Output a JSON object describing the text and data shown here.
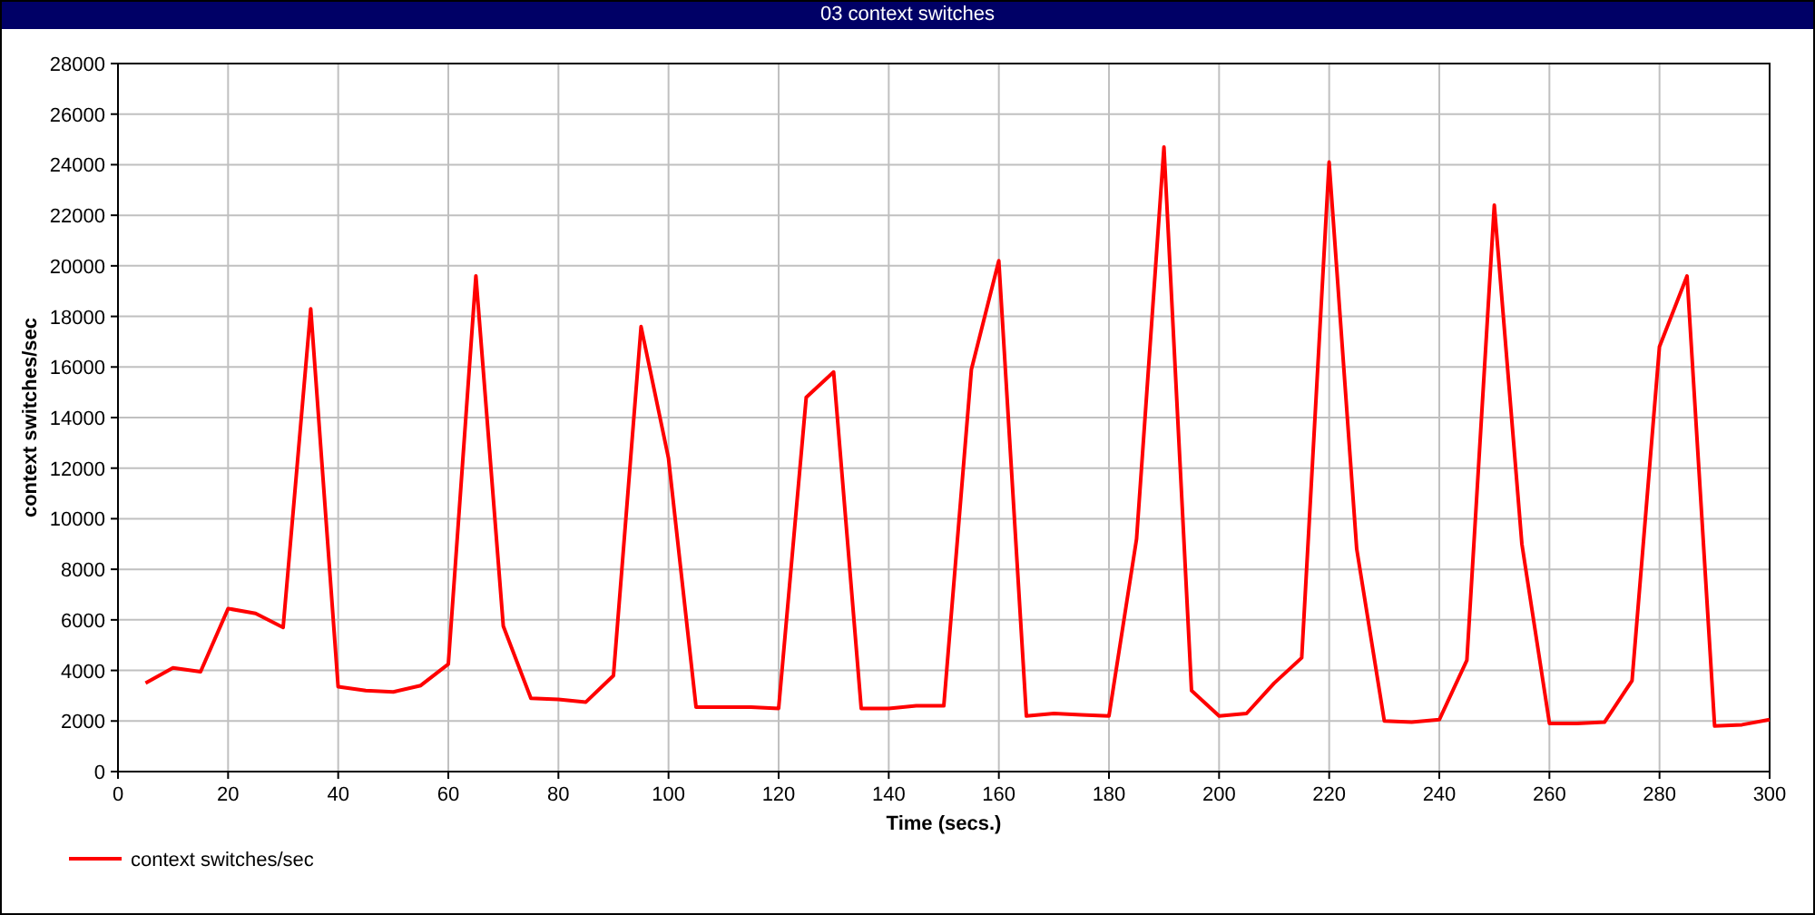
{
  "window": {
    "title": "03 context switches"
  },
  "chart_data": {
    "type": "line",
    "xlabel": "Time (secs.)",
    "ylabel": "context switches/sec",
    "grid": true,
    "xlim": [
      0,
      300
    ],
    "ylim": [
      0,
      28000
    ],
    "xticks": [
      0,
      20,
      40,
      60,
      80,
      100,
      120,
      140,
      160,
      180,
      200,
      220,
      240,
      260,
      280,
      300
    ],
    "yticks": [
      0,
      2000,
      4000,
      6000,
      8000,
      10000,
      12000,
      14000,
      16000,
      18000,
      20000,
      22000,
      24000,
      26000,
      28000
    ],
    "x": [
      5,
      10,
      15,
      20,
      25,
      30,
      35,
      40,
      45,
      50,
      55,
      60,
      65,
      70,
      75,
      80,
      85,
      90,
      95,
      100,
      105,
      110,
      115,
      120,
      125,
      130,
      135,
      140,
      145,
      150,
      155,
      160,
      165,
      170,
      175,
      180,
      185,
      190,
      195,
      200,
      205,
      210,
      215,
      220,
      225,
      230,
      235,
      240,
      245,
      250,
      255,
      260,
      265,
      270,
      275,
      280,
      285,
      290,
      295,
      300
    ],
    "series": [
      {
        "name": "context switches/sec",
        "color": "#ff0000",
        "values": [
          3500,
          4100,
          3950,
          6450,
          6250,
          5700,
          18300,
          3350,
          3200,
          3150,
          3400,
          4250,
          19600,
          5750,
          2900,
          2850,
          2750,
          3800,
          17600,
          12400,
          2550,
          2550,
          2550,
          2500,
          14800,
          15800,
          2500,
          2500,
          2600,
          2600,
          15900,
          20200,
          2200,
          2300,
          2250,
          2200,
          9200,
          24700,
          3200,
          2200,
          2300,
          3500,
          4500,
          24100,
          8800,
          2000,
          1950,
          2050,
          4400,
          22400,
          9000,
          1900,
          1900,
          1950,
          3600,
          16800,
          19600,
          1800,
          1850,
          2050
        ]
      }
    ]
  }
}
